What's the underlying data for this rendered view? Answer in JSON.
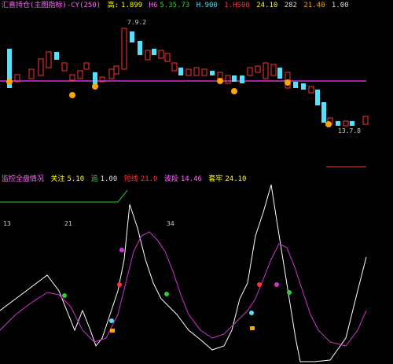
{
  "top_header": {
    "title": "汇喜持仓(主图指标)-CY(250)",
    "v1_label": "高:",
    "v1": "1.899",
    "v2_label": "H6",
    "v2": "5.35.73",
    "v3": "H.900",
    "v4": "1.HS00",
    "v5": "24.10",
    "v6": "282",
    "v7": "21.40",
    "v8": "1.00"
  },
  "top_price_label": "7.9.2",
  "bottom_price_label": "13.7.8",
  "ind_header": {
    "title": "监控全盘情况",
    "item1_label": "关注",
    "item1_value": "5.10",
    "item2_label": "追",
    "item2_value": "1.00",
    "item3_label": "短线",
    "item3_value": "21.0",
    "item4_label": "波段",
    "item4_value": "14.46",
    "item5_label": "套牢",
    "item5_value": "24.10"
  },
  "ind_labels": [
    "13",
    "21",
    "34"
  ],
  "colors": {
    "up": "#ff3333",
    "down": "#54e0ff",
    "magenta": "#d233d2",
    "white": "#ffffff",
    "green": "#33cc33",
    "orange": "#ffa500",
    "yellow": "#ffff00"
  }
}
